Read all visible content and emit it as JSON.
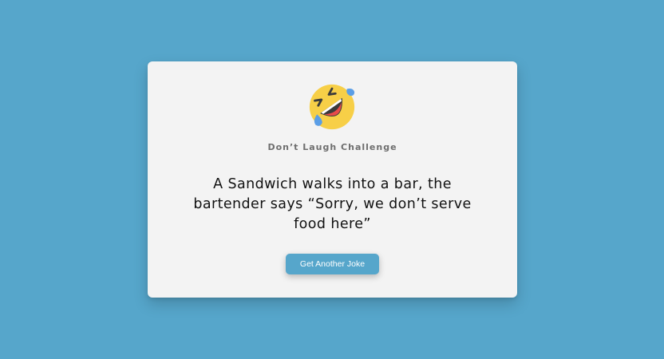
{
  "app": {
    "title": "Don’t Laugh Challenge",
    "emoji_icon": "rolling-on-floor-laughing-icon"
  },
  "joke": {
    "text": "A Sandwich walks into a bar, the bartender says “Sorry, we don’t serve food here”"
  },
  "actions": {
    "next_joke_label": "Get Another Joke"
  },
  "colors": {
    "background": "#56a6cb",
    "card": "#f3f3f3",
    "button": "#56a6cb",
    "emoji_face": "#f7cf47",
    "tear": "#5b9ee6"
  }
}
